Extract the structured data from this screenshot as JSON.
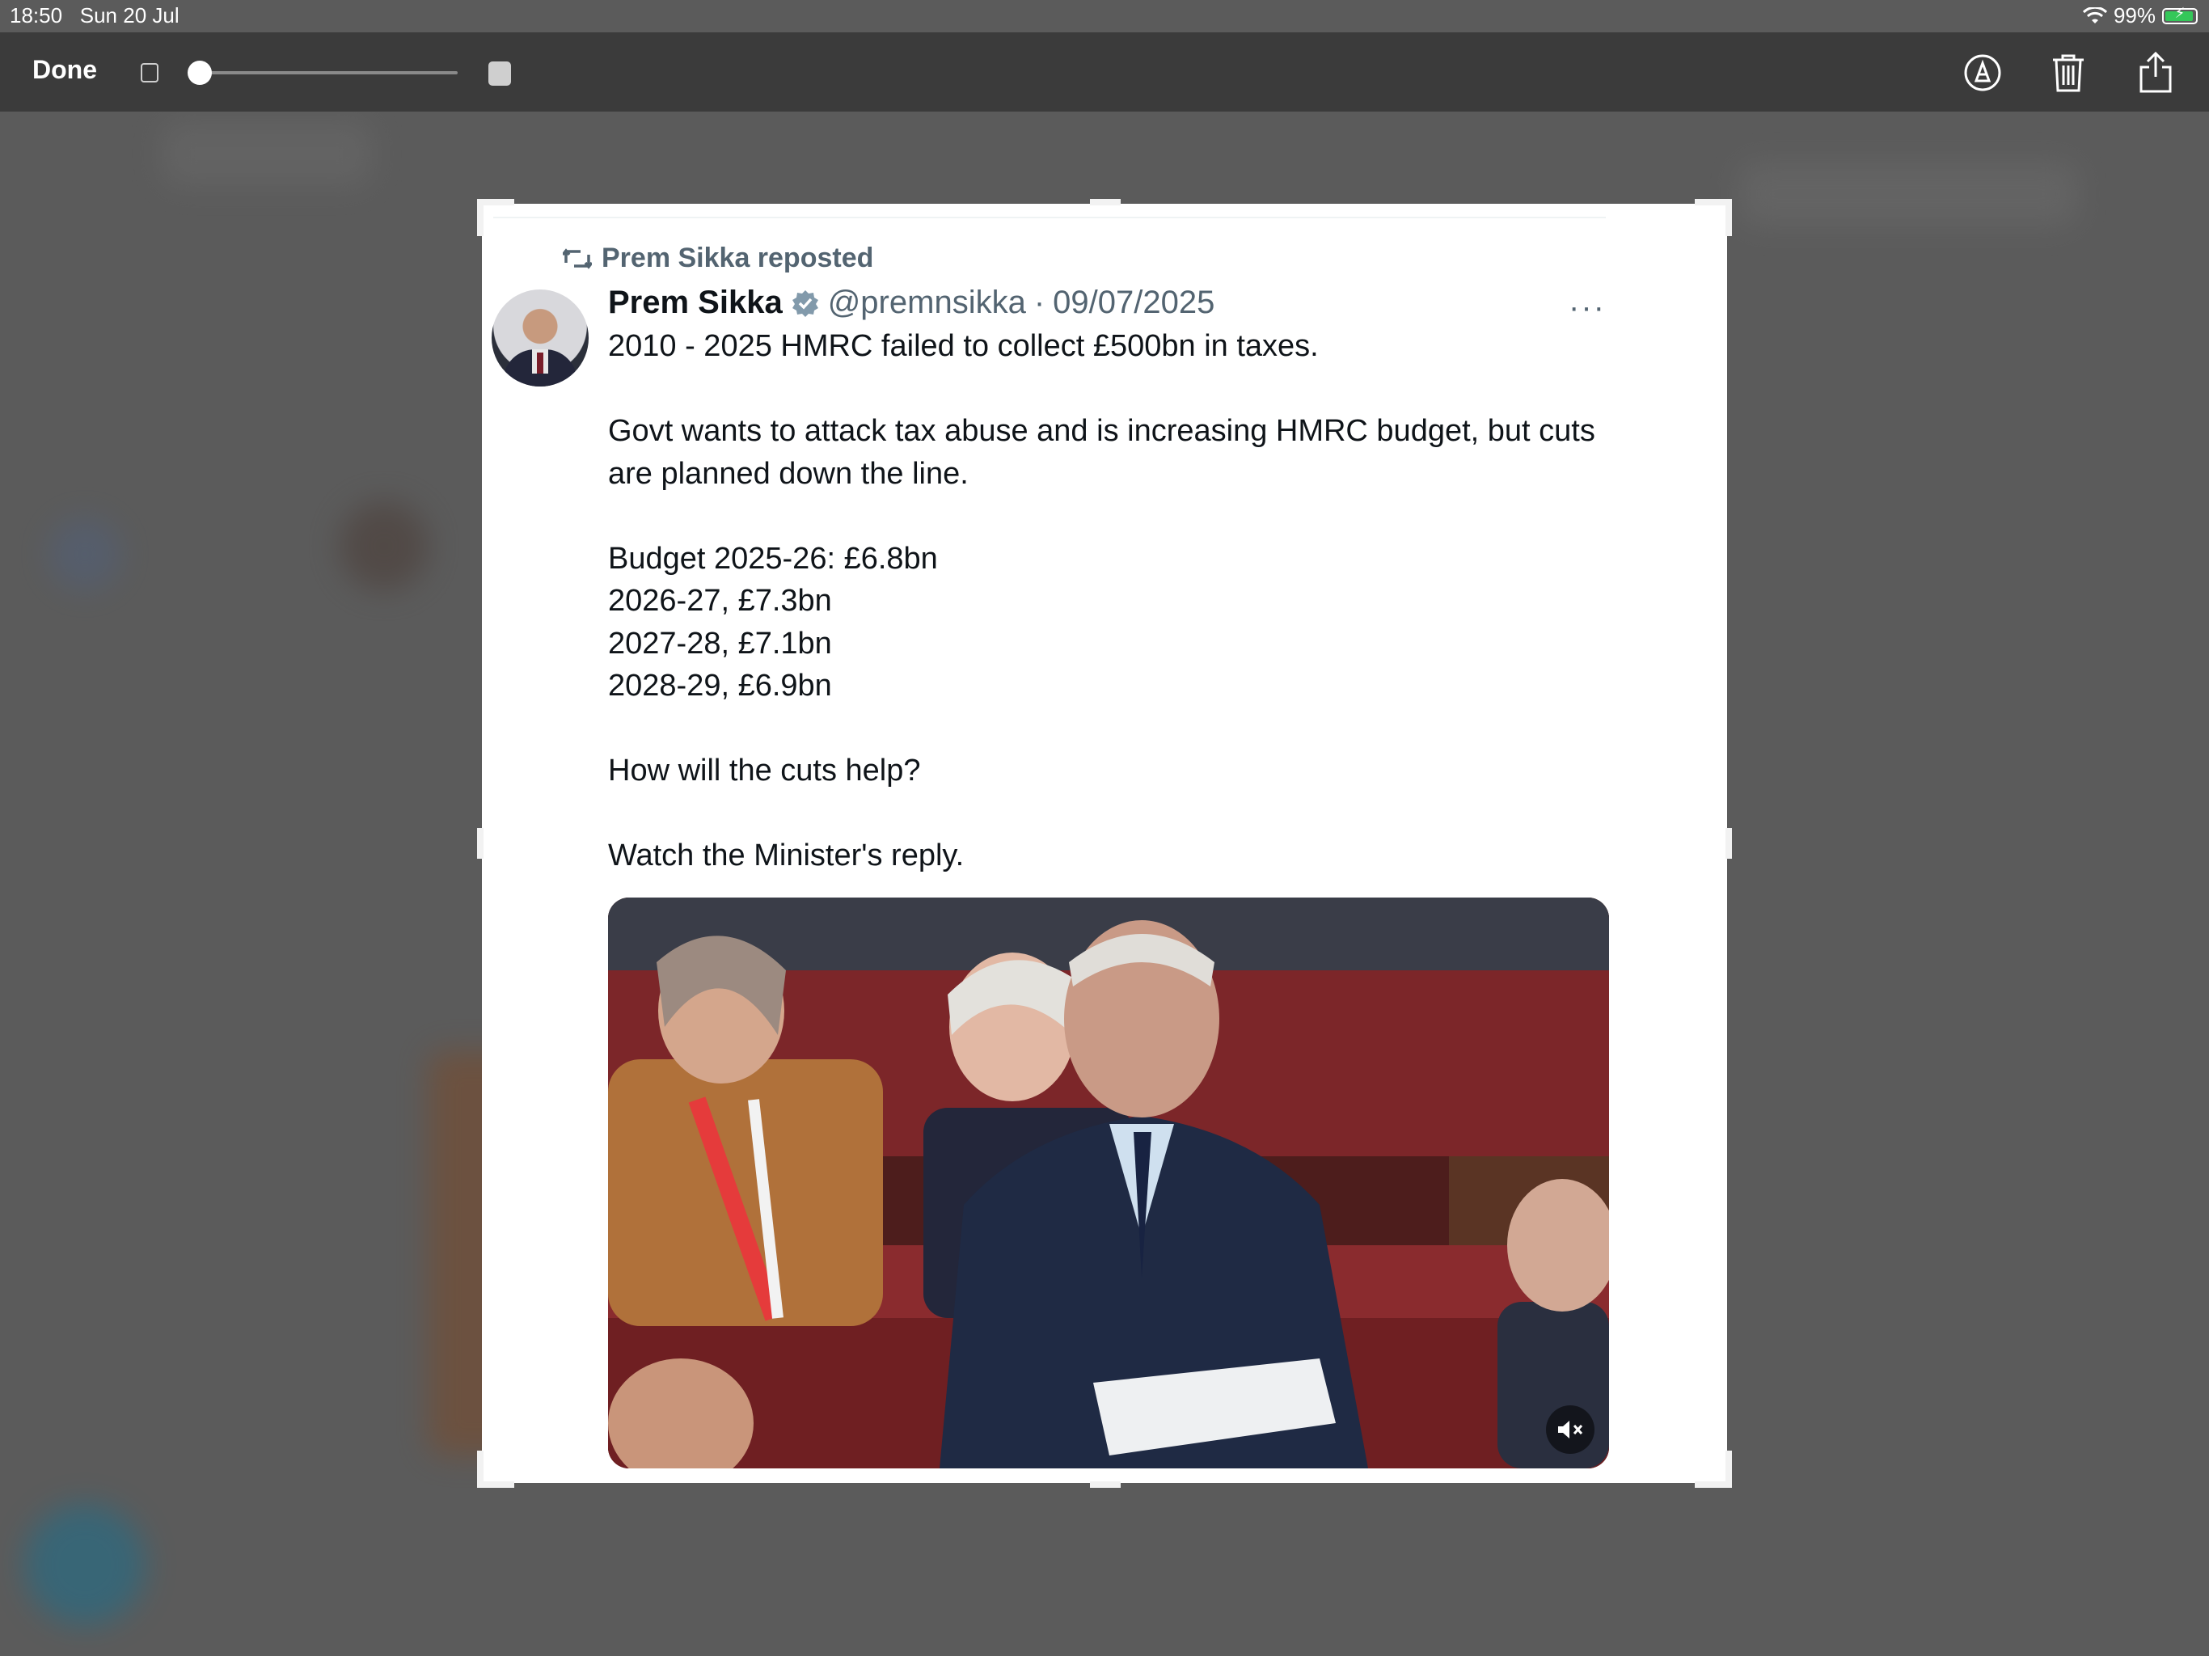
{
  "status_bar": {
    "time": "18:50",
    "date": "Sun 20 Jul",
    "battery": "99%"
  },
  "toolbar": {
    "done_label": "Done",
    "icons": [
      "markup-pen-icon",
      "trash-icon",
      "share-icon"
    ]
  },
  "tweet": {
    "repost_label": "Prem Sikka reposted",
    "author_name": "Prem Sikka",
    "handle": "@premnsikka",
    "separator": "·",
    "date": "09/07/2025",
    "more": "···",
    "text": "2010 - 2025 HMRC failed to collect £500bn in taxes.\n\nGovt wants to attack tax abuse and is increasing HMRC budget, but cuts are planned down the line.\n\nBudget 2025-26: £6.8bn\n2026-27, £7.3bn\n2027-28, £7.1bn\n2028-29, £6.9bn\n\nHow will the cuts help?\n\nWatch the Minister's reply."
  },
  "colors": {
    "toolbar": "#3b3b3b",
    "backdrop": "#5b5b5b",
    "text_primary": "#0f1419",
    "text_secondary": "#536471",
    "verified": "#829aab",
    "battery_fill": "#34c759"
  }
}
